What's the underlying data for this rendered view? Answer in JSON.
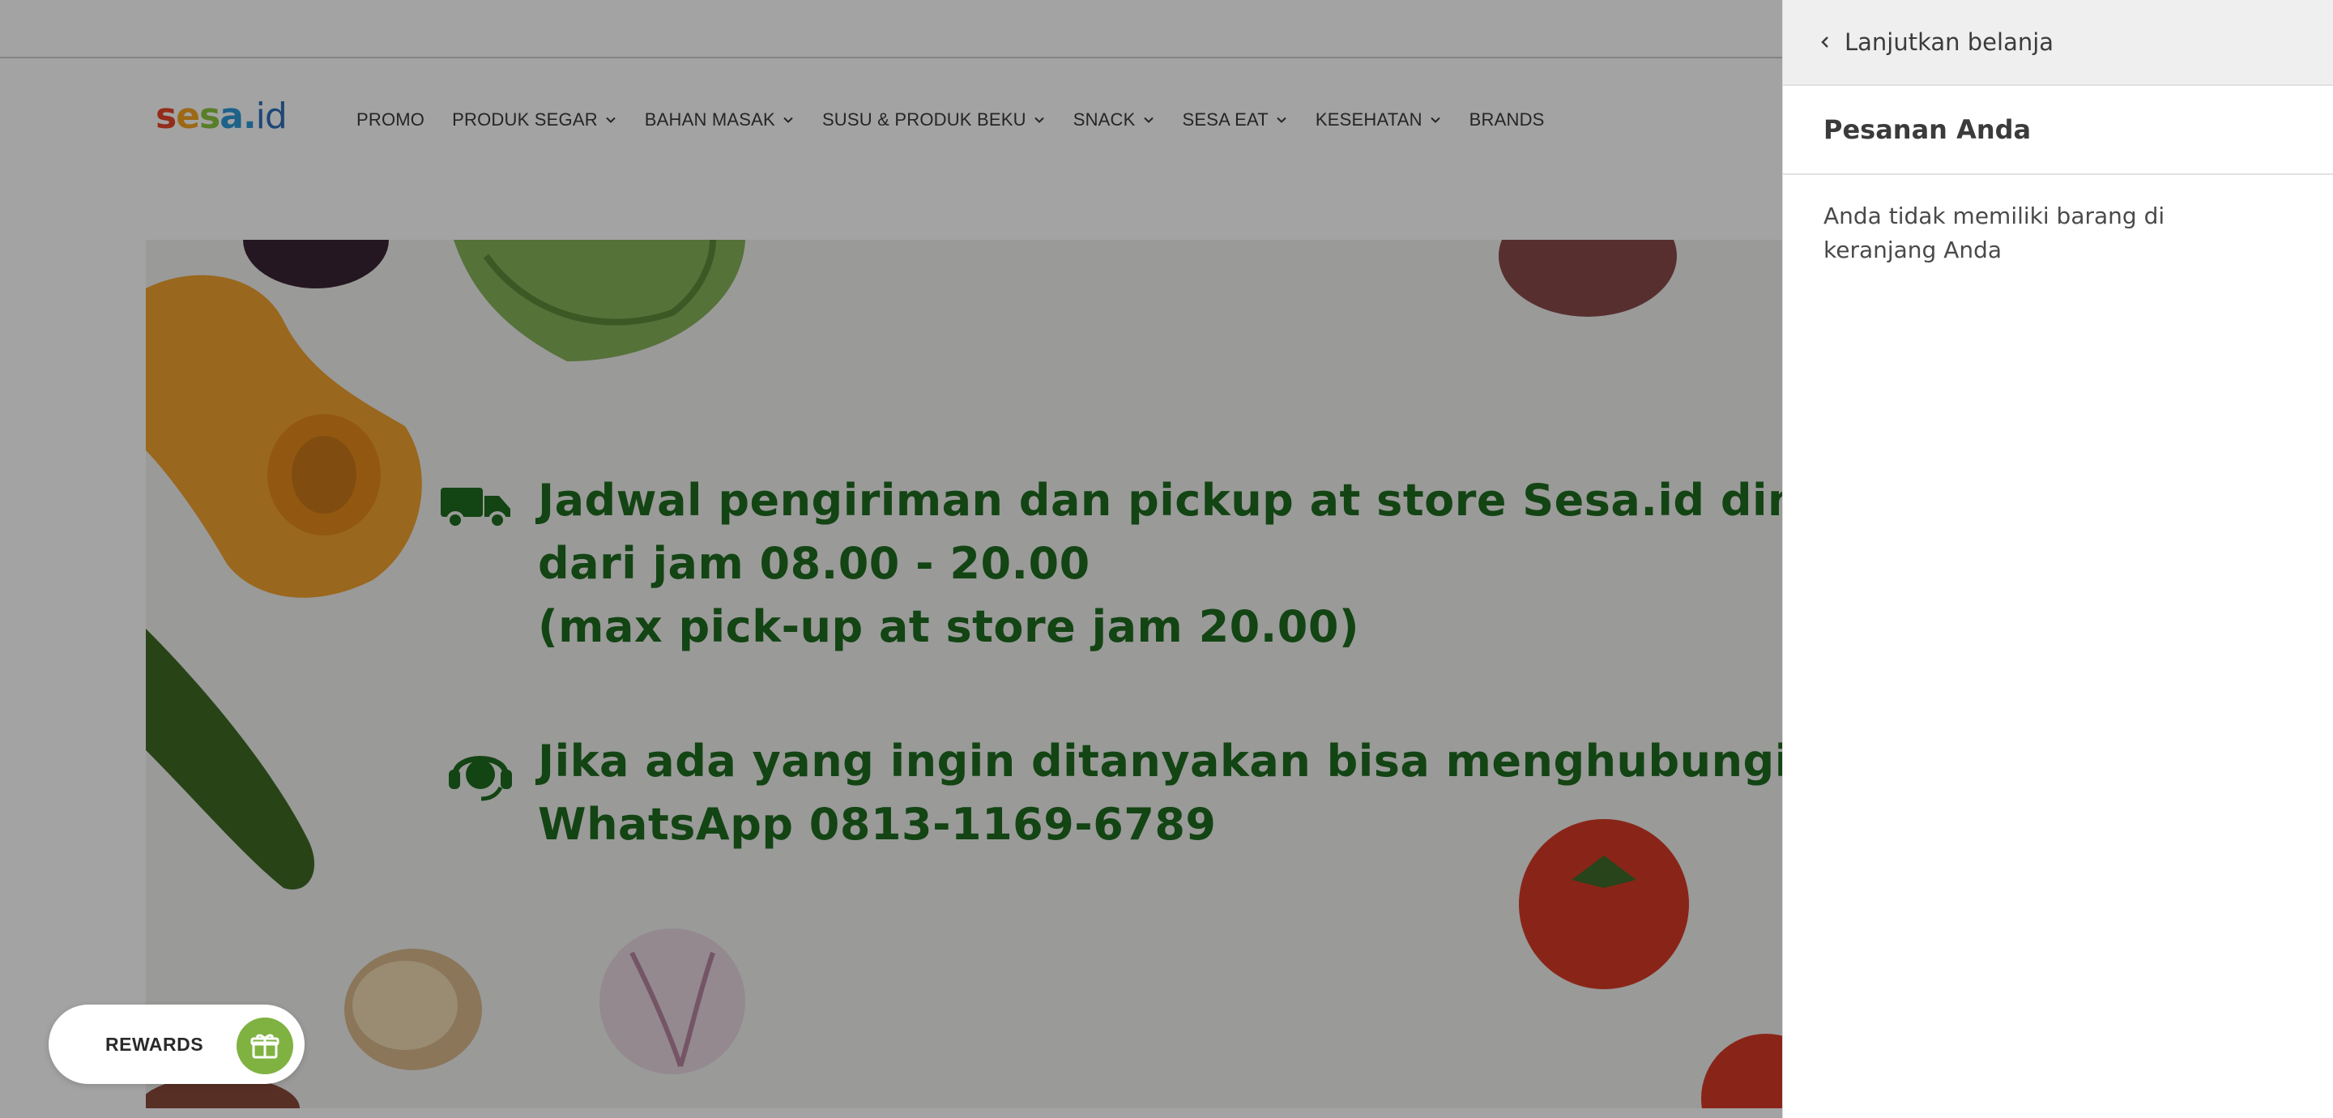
{
  "logo": {
    "part_s1": "s",
    "part_e": "e",
    "part_s2": "s",
    "part_a": "a",
    "part_dot": ".",
    "part_id": "id"
  },
  "nav": {
    "items": [
      {
        "label": "PROMO",
        "has_dropdown": false
      },
      {
        "label": "PRODUK SEGAR",
        "has_dropdown": true
      },
      {
        "label": "BAHAN MASAK",
        "has_dropdown": true
      },
      {
        "label": "SUSU & PRODUK BEKU",
        "has_dropdown": true
      },
      {
        "label": "SNACK",
        "has_dropdown": true
      },
      {
        "label": "SESA EAT",
        "has_dropdown": true
      },
      {
        "label": "KESEHATAN",
        "has_dropdown": true
      },
      {
        "label": "BRANDS",
        "has_dropdown": false
      }
    ]
  },
  "hero": {
    "line1": "Jadwal pengiriman dan pickup at store Sesa.id dimulai",
    "line2": "dari jam 08.00 - 20.00",
    "line3": "(max pick-up at store jam 20.00)",
    "line4": "Jika ada yang ingin ditanyakan bisa menghubungi ke CS kami",
    "line5": "WhatsApp 0813-1169-6789",
    "icons": [
      "delivery-truck-icon",
      "customer-service-headset-icon"
    ],
    "text_color": "#1f6b1f"
  },
  "rewards": {
    "label": "REWARDS",
    "icon": "gift-icon",
    "accent": "#7fb241"
  },
  "cart": {
    "back_label": "Lanjutkan belanja",
    "title": "Pesanan Anda",
    "empty_message": "Anda tidak memiliki barang di keranjang Anda"
  },
  "colors": {
    "overlay": "rgba(0,0,0,0.36)",
    "hero_text": "#1f6b1f",
    "rewards_badge": "#7fb241"
  }
}
